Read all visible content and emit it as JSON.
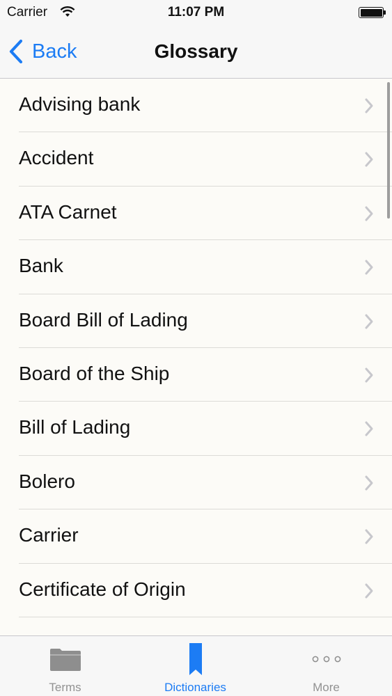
{
  "status_bar": {
    "carrier": "Carrier",
    "time": "11:07 PM"
  },
  "nav": {
    "back_label": "Back",
    "title": "Glossary"
  },
  "terms": [
    {
      "label": "Advising bank"
    },
    {
      "label": "Accident"
    },
    {
      "label": "ATA Carnet"
    },
    {
      "label": "Bank"
    },
    {
      "label": "Board Bill of Lading"
    },
    {
      "label": "Board of the Ship"
    },
    {
      "label": "Bill of Lading"
    },
    {
      "label": "Bolero"
    },
    {
      "label": "Carrier"
    },
    {
      "label": "Certificate of Origin"
    }
  ],
  "tabs": [
    {
      "label": "Terms",
      "icon": "folder-icon",
      "active": false
    },
    {
      "label": "Dictionaries",
      "icon": "bookmark-icon",
      "active": true
    },
    {
      "label": "More",
      "icon": "more-dots-icon",
      "active": false
    }
  ],
  "colors": {
    "accent": "#1c7cf4",
    "inactive": "#929292",
    "list_bg": "#fcfbf7"
  }
}
